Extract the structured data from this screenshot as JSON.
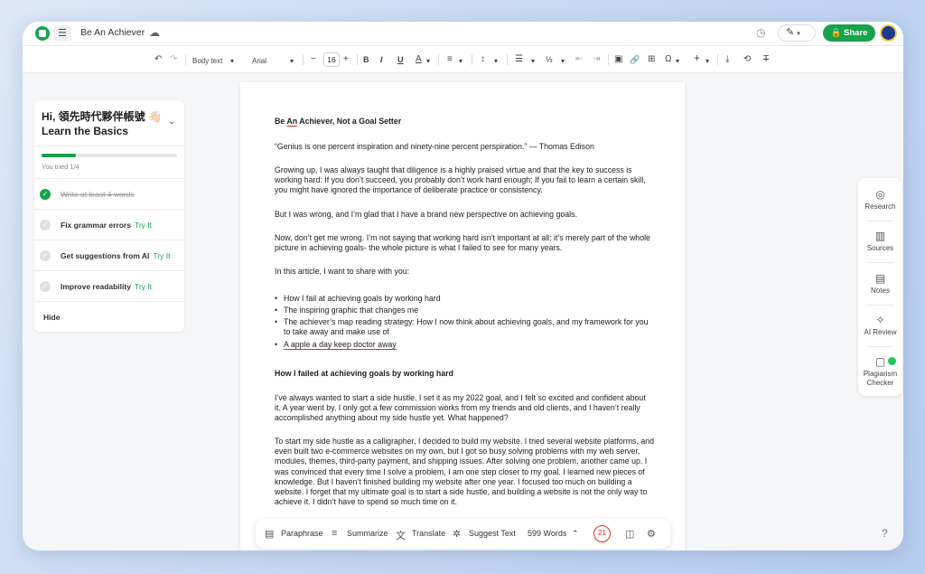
{
  "header": {
    "doc_title": "Be An Achiever",
    "share_label": "Share",
    "icons": [
      "app-logo-icon",
      "menu-icon",
      "cloud-icon",
      "history-icon",
      "pen-icon",
      "lock-icon"
    ]
  },
  "toolbar": {
    "style": "Body text",
    "font": "Arial",
    "font_size": "16",
    "undo": "↶",
    "redo": "↷",
    "minus": "−",
    "plus": "+",
    "bold": "B",
    "italic": "I",
    "underline": "U",
    "text_color": "A",
    "align": "≡",
    "spacing": "↕",
    "bullets": "☰",
    "numbered": "⅓",
    "outdent": "⇤",
    "indent": "⇥",
    "image": "▣",
    "link": "🔗",
    "table": "⊞",
    "omega": "Ω",
    "insert": "+",
    "download": "⤓",
    "replace": "⟲",
    "clear": "T"
  },
  "left_panel": {
    "greeting": "Hi, 領先時代夥伴帳號 👋🏻",
    "subtitle": "Learn the Basics",
    "progress": 0.25,
    "progress_label": "You tried 1/4",
    "tasks": [
      {
        "label": "Write at least 4 words",
        "done": true,
        "try": ""
      },
      {
        "label": "Fix grammar errors",
        "done": false,
        "try": "Try It"
      },
      {
        "label": "Get suggestions from AI",
        "done": false,
        "try": "Try It"
      },
      {
        "label": "Improve readability",
        "done": false,
        "try": "Try It"
      }
    ],
    "hide_label": "Hide"
  },
  "document": {
    "title": "Be An Achiever, Not a Goal Setter",
    "quote": "“Genius is one percent inspiration and ninety-nine percent perspiration.” — Thomas Edison",
    "p1": "Growing up, I was always taught that diligence is a highly praised virtue and that the key to success is working hard: If you don’t succeed, you probably don’t work hard enough; If you fail to learn a certain skill, you might have ignored the importance of deliberate practice or consistency.",
    "p2": "But I was wrong, and I’m glad that I have a brand new perspective on achieving goals.",
    "p3": "Now, don’t get me wrong. I’m not saying that working hard isn’t important at all; it’s merely part of the whole picture in achieving goals- the whole picture is what I failed to see for many years.",
    "p4": "In this article, I want to share with you:",
    "bullets": [
      "How I fail at achieving goals by working hard",
      "The inspiring graphic that changes me",
      "The achiever’s map reading strategy: How I now think about achieving goals, and my framework for you to take away and make use of",
      "A apple a day keep doctor away"
    ],
    "h2": "How I failed at achieving goals by working hard",
    "p5": "I’ve always wanted to start a side hustle. I set it as my 2022 goal, and I felt so excited and confident about it. A year went by, I only got a few commission works from my friends and old clients, and I haven’t really accomplished anything about my side hustle yet. What happened?",
    "p6": "To start my side hustle as a calligrapher, I decided to build my website. I tried several website platforms, and even built two e-commerce websites on my own, but I got so busy solving problems with my web server, modules, themes, third-party payment, and shipping issues. After solving one problem, another came up. I was convinced that every time I solve a problem, I am one step closer to my goal. I learned new pieces of knowledge. But I haven’t finished building my website after one year. I focused too much on building a website. I forget that my ultimate goal is to start a side hustle, and building a website is not the only way to achieve it. I didn’t have to spend so much time on it."
  },
  "bottom_bar": {
    "paraphrase": "Paraphrase",
    "summarize": "Summarize",
    "translate": "Translate",
    "suggest": "Suggest Text",
    "words": "599 Words",
    "issues": "21"
  },
  "right_panel": {
    "items": [
      "Research",
      "Sources",
      "Notes",
      "AI Review",
      "Plagiarism Checker"
    ]
  },
  "help": "?"
}
